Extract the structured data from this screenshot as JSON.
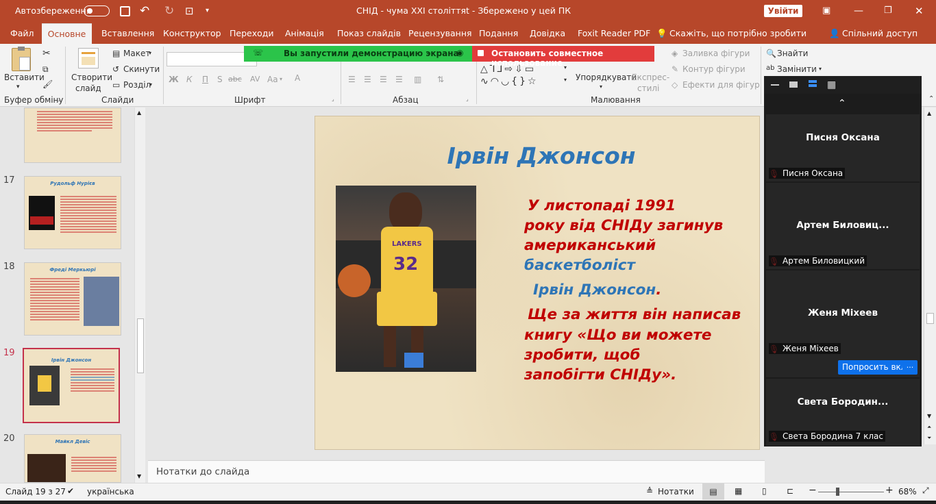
{
  "titlebar": {
    "autosave_label": "Автозбереження",
    "autosave_state": "Вимк",
    "doc_title": "СНІД - чума ХХІ століттяt  -  Збережено у цей ПК",
    "signin_label": "Увійти"
  },
  "tabs": [
    {
      "label": "Файл"
    },
    {
      "label": "Основне"
    },
    {
      "label": "Вставлення"
    },
    {
      "label": "Конструктор"
    },
    {
      "label": "Переходи"
    },
    {
      "label": "Анімація"
    },
    {
      "label": "Показ слайдів"
    },
    {
      "label": "Рецензування"
    },
    {
      "label": "Подання"
    },
    {
      "label": "Довідка"
    },
    {
      "label": "Foxit Reader PDF"
    },
    {
      "label": "Скажіть, що потрібно зробити"
    },
    {
      "label": "Спільний доступ"
    }
  ],
  "ribbon": {
    "paste": "Вставити",
    "clipboard_group": "Буфер обміну",
    "new_slide_line1": "Створити",
    "new_slide_line2": "слайд",
    "layout": "Макет",
    "reset": "Скинути",
    "section": "Розділ",
    "slides_group": "Слайди",
    "font_group": "Шрифт",
    "paragraph_group": "Абзац",
    "arrange": "Упорядкувати",
    "quick_styles_line1": "Експрес-",
    "quick_styles_line2": "стилі",
    "shape_fill": "Заливка фігури",
    "shape_outline": "Контур фігури",
    "shape_effects": "Ефекти для фігур",
    "drawing_group": "Малювання",
    "find": "Знайти",
    "replace": "Замінити",
    "bold": "Ж",
    "italic": "К",
    "underline": "П",
    "strike": "abc",
    "spacing": "AV",
    "case": "Aa"
  },
  "zoom_banner": {
    "green_text": "Вы запустили демонстрацию экрана",
    "red_text": "Остановить совместное использование"
  },
  "thumbnails": [
    {
      "num": "",
      "title": ""
    },
    {
      "num": "17",
      "title": "Рудольф Нурієв"
    },
    {
      "num": "18",
      "title": "Фреді  Меркьюрі"
    },
    {
      "num": "19",
      "title": "Ірвін Джонсон"
    },
    {
      "num": "20",
      "title": "Майкл Девіс"
    }
  ],
  "slide": {
    "title": "Ірвін Джонсон",
    "line1": "У листопаді 1991",
    "line2": "року  від СНІДу загинув",
    "line3": "американський",
    "line4": "баскетболіст",
    "line5": "Ірвін Джонсон",
    "line5_dot": ".",
    "line6": "Ще за життя він написав",
    "line7": "книгу «Що ви можете",
    "line8": "зробити, щоб",
    "line9": "запобігти СНІДу»."
  },
  "notes_placeholder": "Нотатки до слайда",
  "status": {
    "slide_counter": "Слайд 19 з 27",
    "language": "українська",
    "notes_btn": "Нотатки",
    "zoom": "68%"
  },
  "participants": [
    {
      "name_big": "Писня Оксана",
      "name_small": "Писня Оксана"
    },
    {
      "name_big": "Артем  Биловиц...",
      "name_small": "Артем Биловицкий"
    },
    {
      "name_big": "Женя Міхеев",
      "name_small": "Женя Міхеев"
    },
    {
      "name_big": "Света  Бородин...",
      "name_small": "Света Бородина 7 клас"
    }
  ],
  "ask_to_unmute": "Попросить вкл",
  "more_btn": "···",
  "colors": {
    "accent": "#b7472a",
    "slide_red": "#c00000",
    "slide_blue": "#2e75b6",
    "zoom_green": "#2bc44a",
    "zoom_red": "#e23c3c",
    "zoom_blue": "#0e71eb"
  }
}
